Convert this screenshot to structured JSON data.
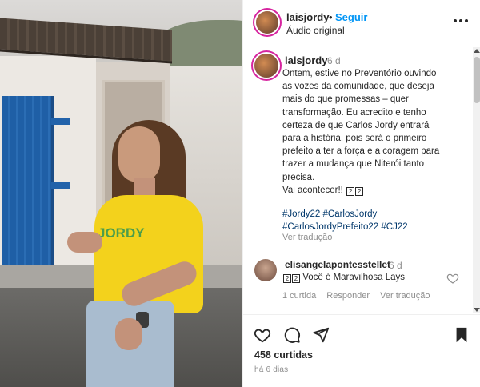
{
  "header": {
    "username": "laisjordy",
    "separator": "•",
    "follow_label": "Seguir",
    "audio_label": "Áudio original"
  },
  "caption": {
    "username": "laisjordy",
    "time": "6 d",
    "lines": [
      "Ontem, estive no Preventório ouvindo",
      "as vozes da comunidade, que deseja",
      "mais do que promessas – quer",
      "transformação. Eu acredito e tenho",
      "certeza de que Carlos Jordy entrará",
      "para a história, pois será o primeiro",
      "prefeito a ter a força e a coragem para",
      "trazer a mudança que Niterói tanto",
      "precisa."
    ],
    "last_line": "Vai acontecer!!",
    "glyphs": [
      "2",
      "2"
    ],
    "hashtags": [
      "#Jordy22 #CarlosJordy",
      "#CarlosJordyPrefeito22 #CJ22"
    ],
    "translate_label": "Ver tradução"
  },
  "comment": {
    "username": "elisangelapontesstellet",
    "time": "6 d",
    "glyphs": [
      "2",
      "2"
    ],
    "text": "Você é Maravilhosa Lays",
    "likes_label": "1 curtida",
    "reply_label": "Responder",
    "translate_label": "Ver tradução"
  },
  "footer": {
    "likes": "458 curtidas",
    "ago": "há 6 dias"
  },
  "photo": {
    "shirt_text": "JORDY"
  },
  "colors": {
    "follow_blue": "#0095f6",
    "hashtag_blue": "#00376b",
    "muted_gray": "#8e8e8e",
    "text_dark": "#262626"
  }
}
